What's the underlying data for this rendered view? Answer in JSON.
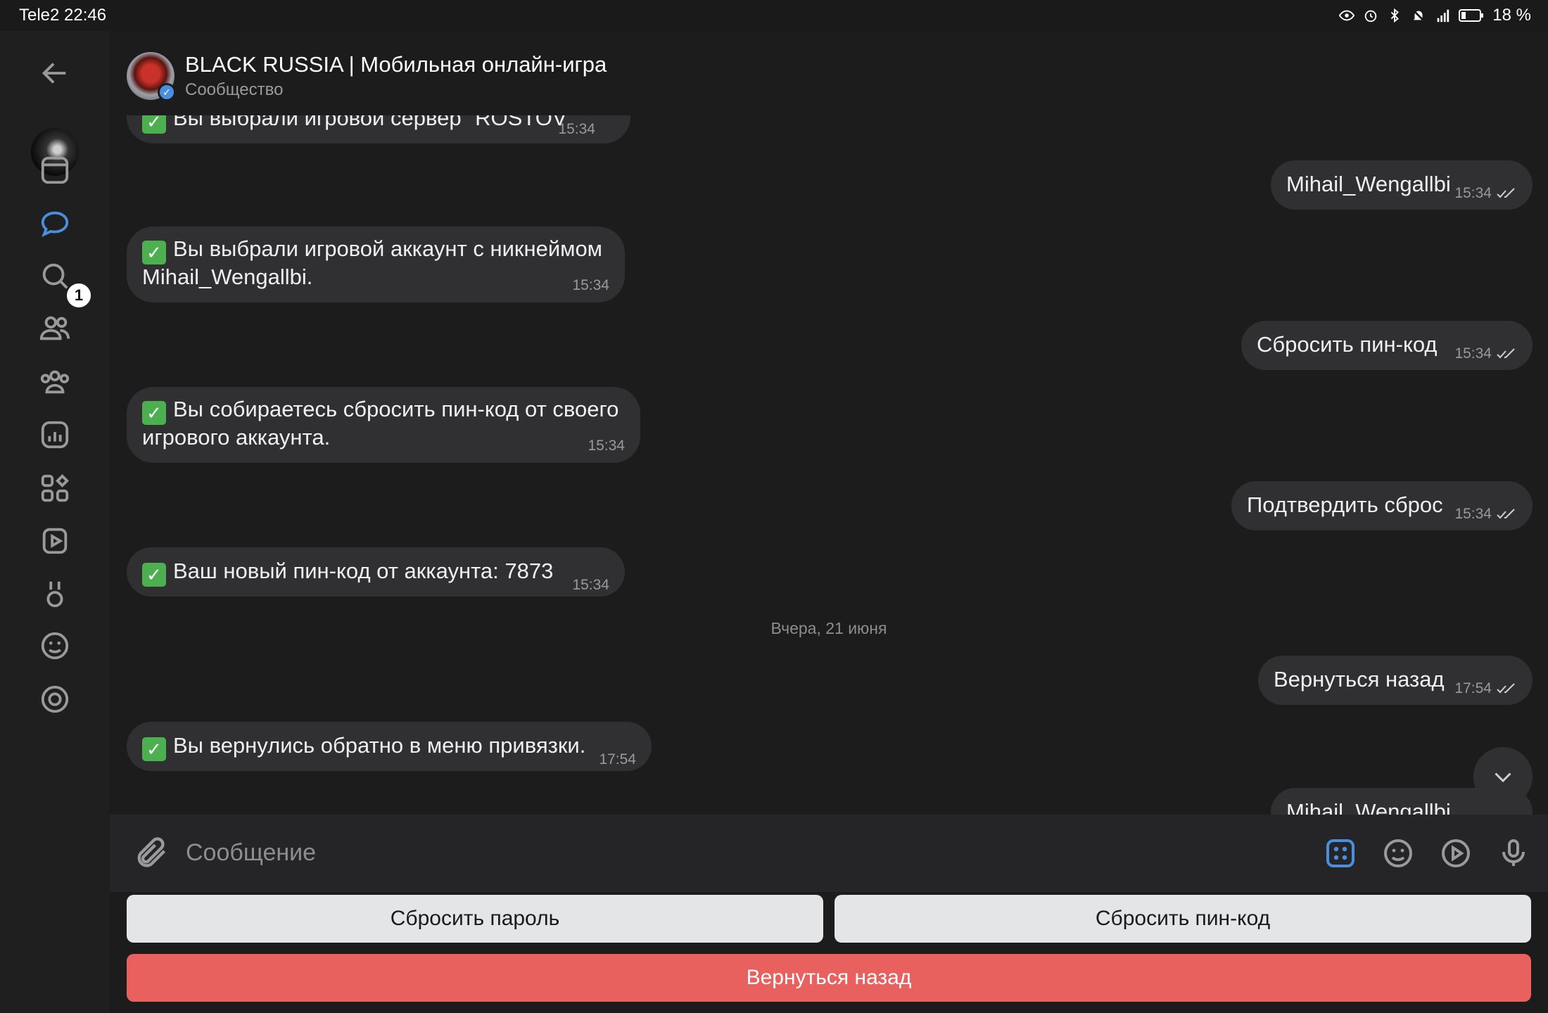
{
  "status_bar": {
    "carrier_time": "Tele2 22:46",
    "battery": "18 %"
  },
  "rail": {
    "unread_badge": "1"
  },
  "header": {
    "title": "BLACK RUSSIA | Мобильная онлайн-игра",
    "subtitle": "Сообщество"
  },
  "messages": [
    {
      "dir": "in",
      "text": "Вы выбрали игровой сервер \"ROSTOV\"",
      "time": "15:34"
    },
    {
      "dir": "out",
      "text": "Mihail_Wengallbi",
      "time": "15:34"
    },
    {
      "dir": "in",
      "text_line1": "Вы выбрали игровой аккаунт с никнеймом",
      "text_line2": "Mihail_Wengallbi.",
      "time": "15:34"
    },
    {
      "dir": "out",
      "text": "Сбросить пин-код",
      "time": "15:34"
    },
    {
      "dir": "in",
      "text_line1": "Вы собираетесь сбросить пин-код от своего",
      "text_line2": "игрового аккаунта.",
      "time": "15:34"
    },
    {
      "dir": "out",
      "text": "Подтвердить сброс",
      "time": "15:34"
    },
    {
      "dir": "in",
      "text": "Ваш новый пин-код от аккаунта: 7873",
      "time": "15:34"
    },
    {
      "dir": "out",
      "text": "Вернуться назад",
      "time": "17:54"
    },
    {
      "dir": "in",
      "text": "Вы вернулись обратно в меню привязки.",
      "time": "17:54"
    },
    {
      "dir": "out",
      "text": "Mihail_Wengallbi",
      "time": ""
    }
  ],
  "date_separator": "Вчера, 21 июня",
  "composer": {
    "placeholder": "Сообщение"
  },
  "keyboard": {
    "btn_reset_password": "Сбросить пароль",
    "btn_reset_pin": "Сбросить пин-код",
    "btn_back": "Вернуться назад"
  },
  "colors": {
    "accent": "#4a8ee0",
    "danger_button": "#e8615e",
    "check_green": "#4caf50"
  }
}
